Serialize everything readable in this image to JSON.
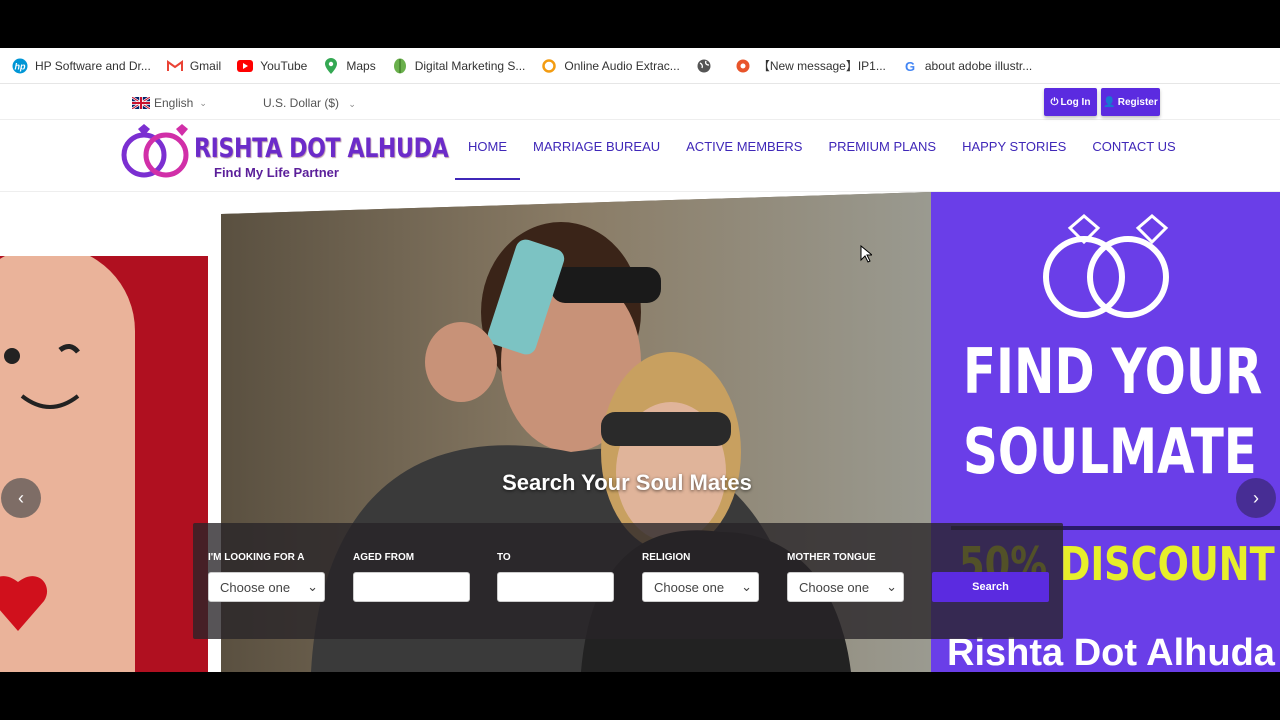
{
  "bookmarks": [
    {
      "label": "HP Software and Dr...",
      "icon": "hp-icon"
    },
    {
      "label": "Gmail",
      "icon": "gmail-icon"
    },
    {
      "label": "YouTube",
      "icon": "youtube-icon"
    },
    {
      "label": "Maps",
      "icon": "maps-icon"
    },
    {
      "label": "Digital Marketing S...",
      "icon": "leaf-icon"
    },
    {
      "label": "Online Audio Extrac...",
      "icon": "audio-icon"
    },
    {
      "label": "",
      "icon": "globe-icon"
    },
    {
      "label": "【New message】IP1...",
      "icon": "message-icon"
    },
    {
      "label": "about adobe illustr...",
      "icon": "google-icon"
    }
  ],
  "util": {
    "language": "English",
    "currency": "U.S. Dollar ($)",
    "login_label": "Log In",
    "register_label": "Register"
  },
  "logo": {
    "title": "RISHTA DOT ALHUDA",
    "subtitle": "Find My Life Partner"
  },
  "nav": {
    "items": [
      "HOME",
      "MARRIAGE BUREAU",
      "ACTIVE MEMBERS",
      "PREMIUM PLANS",
      "HAPPY STORIES",
      "CONTACT US"
    ],
    "active": "HOME"
  },
  "hero": {
    "title": "Search Your Soul Mates",
    "promo_line1": "FIND YOUR",
    "promo_line2": "SOULMATE",
    "promo_discount": "50% DISCOUNT",
    "promo_brand": "Rishta Dot Alhuda"
  },
  "search": {
    "looking_for_label": "I'M LOOKING FOR A",
    "looking_for_value": "Choose one",
    "aged_from_label": "AGED FROM",
    "aged_from_value": "",
    "to_label": "TO",
    "to_value": "",
    "religion_label": "RELIGION",
    "religion_value": "Choose one",
    "tongue_label": "MOTHER TONGUE",
    "tongue_value": "Choose one",
    "button_label": "Search"
  },
  "colors": {
    "accent": "#5b2be0",
    "nav_text": "#3f27b8",
    "promo_bg": "#6a3ee8",
    "discount": "#e7ef2a"
  }
}
